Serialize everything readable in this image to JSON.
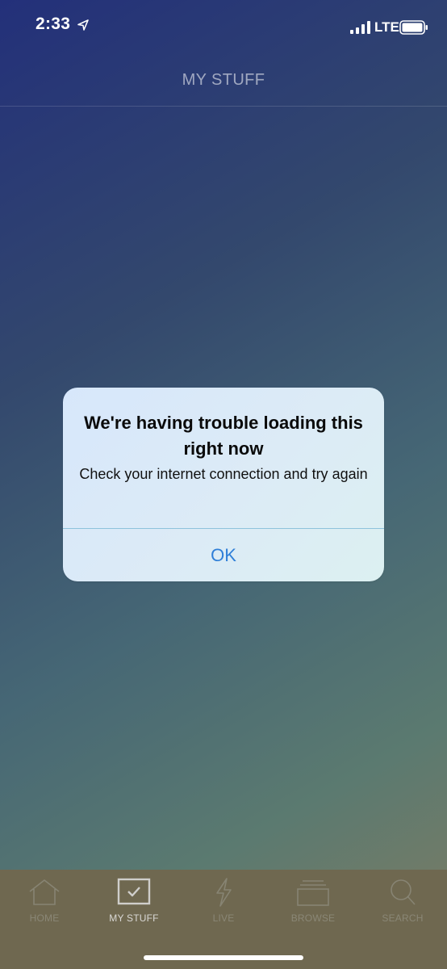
{
  "status_bar": {
    "time": "2:33",
    "network": "LTE",
    "icons": [
      "location-arrow-icon",
      "signal-bars-icon",
      "battery-icon"
    ]
  },
  "header": {
    "title": "MY STUFF"
  },
  "alert": {
    "title": "We're having trouble loading this right now",
    "message": "Check your internet connection and try again",
    "ok_label": "OK"
  },
  "tab_bar": {
    "active": "MY STUFF",
    "items": [
      {
        "label": "HOME",
        "icon": "home-icon"
      },
      {
        "label": "MY STUFF",
        "icon": "checkbox-icon"
      },
      {
        "label": "LIVE",
        "icon": "lightning-icon"
      },
      {
        "label": "BROWSE",
        "icon": "stack-icon"
      },
      {
        "label": "SEARCH",
        "icon": "search-icon"
      }
    ]
  },
  "colors": {
    "alert_button": "#2f7fd8",
    "tab_bar_bg": "#6f6850",
    "gradient_top": "#23307a",
    "gradient_bottom": "#7f7c63"
  }
}
